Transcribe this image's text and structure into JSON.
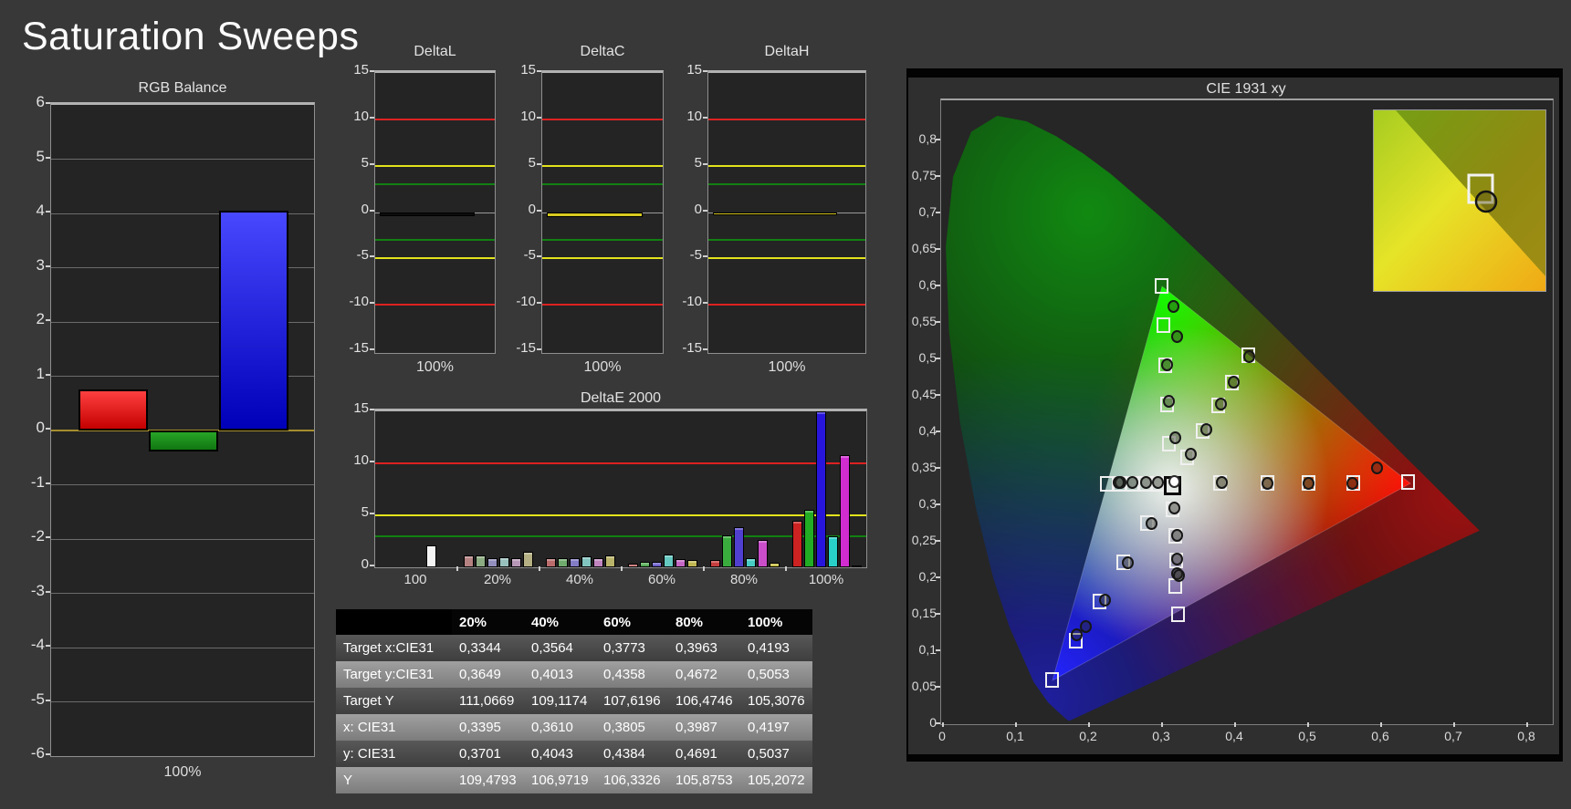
{
  "page_title": "Saturation Sweeps",
  "colors": {
    "background": "#383838",
    "plot_background": "#242424",
    "limit_red": "#dd2121",
    "limit_yellow": "#e3e31c",
    "limit_green": "#128012",
    "zero_line_rgb": "#a58d2e"
  },
  "chart_data": {
    "rgb_balance": {
      "type": "bar",
      "title": "RGB Balance",
      "x_label": "100%",
      "ylim": [
        -6,
        6
      ],
      "y_ticks": [
        6,
        5,
        4,
        3,
        2,
        1,
        0,
        -1,
        -2,
        -3,
        -4,
        -5,
        -6
      ],
      "bars": [
        {
          "name": "red",
          "value": 0.75,
          "color_top": "#ff4040",
          "color_bottom": "#c40000"
        },
        {
          "name": "green",
          "value": -0.38,
          "color_top": "#27a527",
          "color_bottom": "#117611"
        },
        {
          "name": "blue",
          "value": 4.05,
          "color_top": "#4848ff",
          "color_bottom": "#0000b8"
        }
      ]
    },
    "delta_small": {
      "ylim": [
        -15,
        15
      ],
      "y_ticks": [
        15,
        10,
        5,
        0,
        -5,
        -10,
        -15
      ],
      "limit_lines": [
        {
          "value": 10,
          "color": "#dd2121"
        },
        {
          "value": -10,
          "color": "#dd2121"
        },
        {
          "value": 5,
          "color": "#e3e31c"
        },
        {
          "value": -5,
          "color": "#e3e31c"
        },
        {
          "value": 3,
          "color": "#128012"
        },
        {
          "value": -3,
          "color": "#128012"
        }
      ],
      "charts": [
        {
          "title": "DeltaL",
          "x_label": "100%",
          "value": -0.4,
          "bar_color": "#0d0d0d"
        },
        {
          "title": "DeltaC",
          "x_label": "100%",
          "value": -0.55,
          "bar_color": "#d8ca20"
        },
        {
          "title": "DeltaH",
          "x_label": "100%",
          "value": -0.35,
          "bar_color": "#d8ca20"
        }
      ]
    },
    "delta_e2000": {
      "type": "bar",
      "title": "DeltaE 2000",
      "ylim": [
        0,
        15
      ],
      "y_ticks": [
        15,
        10,
        5,
        0
      ],
      "limit_lines": [
        {
          "value": 10,
          "color": "#dd2121"
        },
        {
          "value": 5,
          "color": "#e3e31c"
        },
        {
          "value": 3,
          "color": "#128012"
        }
      ],
      "series": [
        "red",
        "green",
        "blue",
        "cyan",
        "magenta",
        "yellow"
      ],
      "groups": [
        {
          "label": "100",
          "values": [
            2.1
          ],
          "colors": [
            "#f4f4f4"
          ]
        },
        {
          "label": "20%",
          "values": [
            1.1,
            1.15,
            0.85,
            1.0,
            0.9,
            1.5
          ],
          "colors": [
            "#b58282",
            "#8cab82",
            "#938fbe",
            "#98c0bc",
            "#b797b6",
            "#b5b083"
          ]
        },
        {
          "label": "40%",
          "values": [
            0.9,
            0.9,
            0.85,
            1.05,
            0.9,
            1.1
          ],
          "colors": [
            "#ba6c6c",
            "#70ab6e",
            "#837dc6",
            "#82c4bf",
            "#c085bf",
            "#bab36a"
          ]
        },
        {
          "label": "60%",
          "values": [
            0.35,
            0.5,
            0.55,
            1.2,
            0.8,
            0.7
          ],
          "colors": [
            "#c05555",
            "#55ab55",
            "#6b5ec9",
            "#65c8c1",
            "#c568c5",
            "#c0b752"
          ]
        },
        {
          "label": "80%",
          "values": [
            0.7,
            3.1,
            3.9,
            0.9,
            2.6,
            0.4
          ],
          "colors": [
            "#c63e3e",
            "#3aac3e",
            "#5140d0",
            "#48ccc4",
            "#ca4eca",
            "#c6bc3a"
          ]
        },
        {
          "label": "100%",
          "values": [
            4.5,
            5.5,
            15.0,
            3.0,
            10.8,
            0.2
          ],
          "colors": [
            "#cc2222",
            "#22ac24",
            "#2815db",
            "#28d0c8",
            "#d02cd0",
            "#cdc022"
          ]
        }
      ]
    },
    "cie": {
      "type": "scatter",
      "title": "CIE 1931 xy",
      "xlim": [
        0,
        0.8
      ],
      "ylim": [
        0,
        0.85
      ],
      "x_tick_labels": [
        "0",
        "0,1",
        "0,2",
        "0,3",
        "0,4",
        "0,5",
        "0,6",
        "0,7",
        "0,8"
      ],
      "y_tick_labels": [
        "0",
        "0,05",
        "0,1",
        "0,15",
        "0,2",
        "0,25",
        "0,3",
        "0,35",
        "0,4",
        "0,45",
        "0,5",
        "0,55",
        "0,6",
        "0,65",
        "0,7",
        "0,75",
        "0,8"
      ],
      "white_point": {
        "target": [
          0.3127,
          0.329
        ],
        "measured": [
          0.3165,
          0.332
        ]
      },
      "sweeps": {
        "red": {
          "targets": [
            [
              0.38,
              0.3295
            ],
            [
              0.4445,
              0.33
            ],
            [
              0.5015,
              0.33
            ],
            [
              0.5625,
              0.3305
            ],
            [
              0.638,
              0.331
            ]
          ],
          "measured": [
            [
              0.3815,
              0.3315
            ],
            [
              0.4445,
              0.3305
            ],
            [
              0.5,
              0.33
            ],
            [
              0.56,
              0.33
            ],
            [
              0.594,
              0.3515
            ]
          ]
        },
        "green": {
          "targets": [
            [
              0.3102,
              0.3832
            ],
            [
              0.3076,
              0.4374
            ],
            [
              0.3051,
              0.4916
            ],
            [
              0.3025,
              0.5458
            ],
            [
              0.3,
              0.6
            ]
          ],
          "measured": [
            [
              0.3175,
              0.3925
            ],
            [
              0.3095,
              0.4425
            ],
            [
              0.307,
              0.493
            ],
            [
              0.32,
              0.531
            ],
            [
              0.316,
              0.572
            ]
          ]
        },
        "blue": {
          "targets": [
            [
              0.2802,
              0.2752
            ],
            [
              0.2476,
              0.2214
            ],
            [
              0.2151,
              0.1676
            ],
            [
              0.1825,
              0.1138
            ],
            [
              0.15,
              0.06
            ]
          ],
          "measured": [
            [
              0.285,
              0.275
            ],
            [
              0.253,
              0.221
            ],
            [
              0.2215,
              0.17
            ],
            [
              0.183,
              0.123
            ],
            [
              0.196,
              0.134
            ]
          ]
        },
        "cyan": {
          "targets": [
            [
              0.2951,
              0.3289
            ],
            [
              0.2775,
              0.3289
            ],
            [
              0.2599,
              0.3288
            ],
            [
              0.2422,
              0.3288
            ],
            [
              0.2246,
              0.3287
            ]
          ],
          "measured": [
            [
              0.2945,
              0.3315
            ],
            [
              0.2785,
              0.3315
            ],
            [
              0.2595,
              0.3315
            ],
            [
              0.2435,
              0.331
            ],
            [
              0.24,
              0.3318
            ]
          ]
        },
        "magenta": {
          "targets": [
            [
              0.3148,
              0.294
            ],
            [
              0.319,
              0.2575
            ],
            [
              0.32,
              0.224
            ],
            [
              0.319,
              0.189
            ],
            [
              0.322,
              0.15
            ]
          ],
          "measured": [
            [
              0.317,
              0.296
            ],
            [
              0.32,
              0.259
            ],
            [
              0.321,
              0.226
            ],
            [
              0.3205,
              0.206
            ],
            [
              0.3235,
              0.2035
            ]
          ]
        },
        "yellow": {
          "targets": [
            [
              0.3344,
              0.3649
            ],
            [
              0.3564,
              0.4013
            ],
            [
              0.3773,
              0.4358
            ],
            [
              0.3963,
              0.4672
            ],
            [
              0.4193,
              0.5053
            ]
          ],
          "measured": [
            [
              0.3395,
              0.3701
            ],
            [
              0.361,
              0.4043
            ],
            [
              0.3805,
              0.4384
            ],
            [
              0.3987,
              0.4691
            ],
            [
              0.4197,
              0.5037
            ]
          ]
        }
      },
      "inset": {
        "square": [
          0.615,
          0.43
        ],
        "circle": [
          0.645,
          0.5
        ]
      }
    }
  },
  "table": {
    "columns": [
      "",
      "20%",
      "40%",
      "60%",
      "80%",
      "100%"
    ],
    "rows": [
      {
        "label": "Target x:CIE31",
        "values": [
          "0,3344",
          "0,3564",
          "0,3773",
          "0,3963",
          "0,4193"
        ]
      },
      {
        "label": "Target y:CIE31",
        "values": [
          "0,3649",
          "0,4013",
          "0,4358",
          "0,4672",
          "0,5053"
        ]
      },
      {
        "label": "Target Y",
        "values": [
          "111,0669",
          "109,1174",
          "107,6196",
          "106,4746",
          "105,3076"
        ]
      },
      {
        "label": "x: CIE31",
        "values": [
          "0,3395",
          "0,3610",
          "0,3805",
          "0,3987",
          "0,4197"
        ]
      },
      {
        "label": "y: CIE31",
        "values": [
          "0,3701",
          "0,4043",
          "0,4384",
          "0,4691",
          "0,5037"
        ]
      },
      {
        "label": "Y",
        "values": [
          "109,4793",
          "106,9719",
          "106,3326",
          "105,8753",
          "105,2072"
        ]
      }
    ]
  }
}
